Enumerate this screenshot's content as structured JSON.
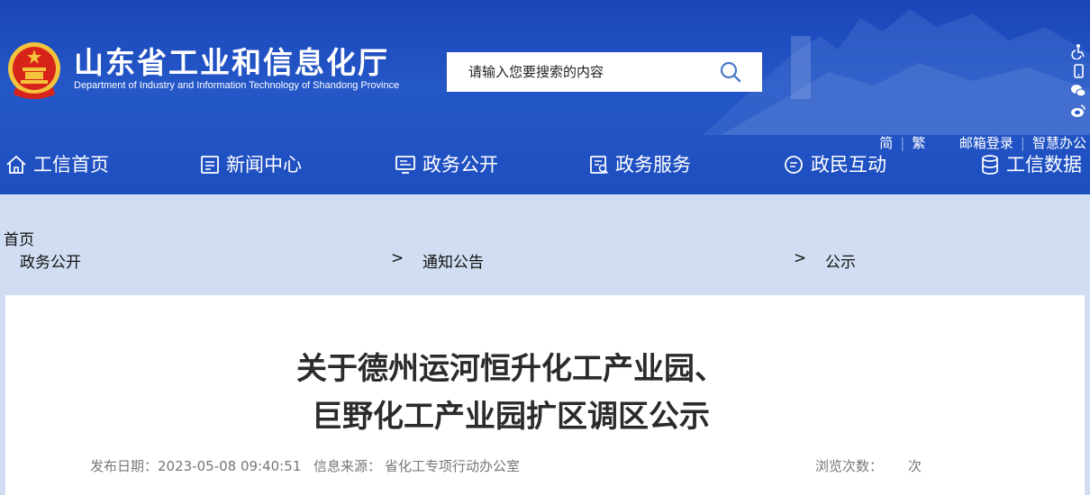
{
  "site": {
    "title": "山东省工业和信息化厅",
    "subtitle": "Department of Industry and Information Technology of Shandong Province"
  },
  "search": {
    "placeholder": "请输入您要搜索的内容"
  },
  "top_links": {
    "simplified": "简",
    "traditional": "繁",
    "mail_login": "邮箱登录",
    "smart_office": "智慧办公"
  },
  "side_icons": [
    "accessibility-icon",
    "mobile-icon",
    "wechat-icon",
    "weibo-icon"
  ],
  "nav": [
    {
      "label": "工信首页",
      "icon": "home-icon"
    },
    {
      "label": "新闻中心",
      "icon": "news-icon"
    },
    {
      "label": "政务公开",
      "icon": "monitor-icon"
    },
    {
      "label": "政务服务",
      "icon": "service-icon"
    },
    {
      "label": "政民互动",
      "icon": "chat-icon"
    },
    {
      "label": "工信数据",
      "icon": "database-icon"
    }
  ],
  "breadcrumb": {
    "home": "首页",
    "items": [
      "政务公开",
      "通知公告",
      "公示"
    ],
    "separator": ">"
  },
  "article": {
    "title_line1": "关于德州运河恒升化工产业园、",
    "title_line2": "巨野化工产业园扩区调区公示",
    "publish_label": "发布日期：",
    "publish_date": "2023-05-08 09:40:51",
    "source_label": "信息来源：",
    "source": "省化工专项行动办公室",
    "views_label": "浏览次数：",
    "views_unit": "次"
  },
  "colors": {
    "header_blue": "#2457c8",
    "page_bg": "#d1ddf2",
    "emblem_red": "#d8231b",
    "emblem_gold": "#f3c33c"
  }
}
